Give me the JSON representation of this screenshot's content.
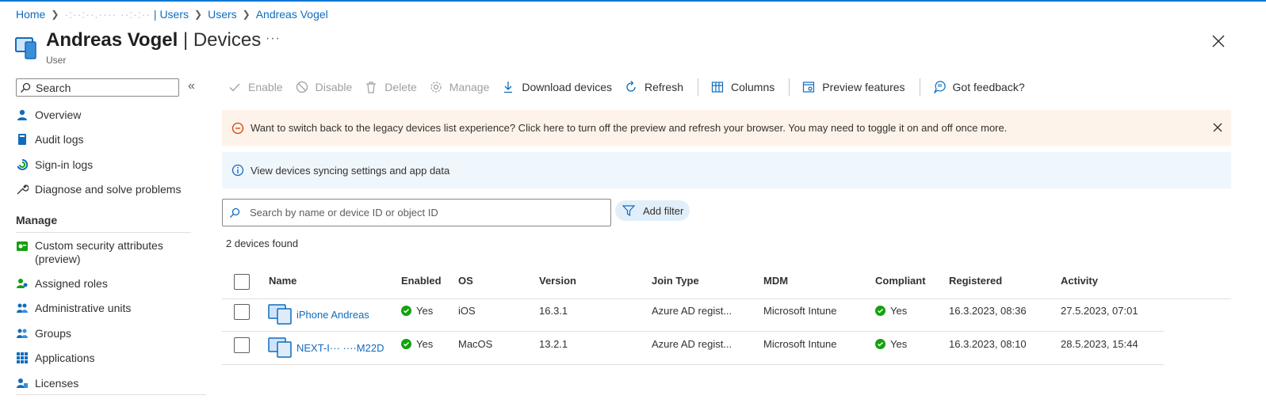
{
  "breadcrumb": {
    "home": "Home",
    "tenant": "·:··:··.···· ··:·:··",
    "tenant_suffix": "| Users",
    "users": "Users",
    "user": "Andreas Vogel"
  },
  "header": {
    "name": "Andreas Vogel",
    "section": "| Devices",
    "subtitle": "User",
    "more": "···"
  },
  "sidebar": {
    "search_placeholder": "Search",
    "collapse": "«",
    "items": [
      {
        "label": "Overview",
        "icon": "person-icon"
      },
      {
        "label": "Audit logs",
        "icon": "book-icon"
      },
      {
        "label": "Sign-in logs",
        "icon": "signin-icon"
      },
      {
        "label": "Diagnose and solve problems",
        "icon": "wrench-icon"
      }
    ],
    "manage_heading": "Manage",
    "manage_items": [
      {
        "label": "Custom security attributes",
        "label2": "(preview)",
        "icon": "attributes-icon"
      },
      {
        "label": "Assigned roles",
        "icon": "roles-icon"
      },
      {
        "label": "Administrative units",
        "icon": "units-icon"
      },
      {
        "label": "Groups",
        "icon": "groups-icon"
      },
      {
        "label": "Applications",
        "icon": "apps-icon"
      },
      {
        "label": "Licenses",
        "icon": "licenses-icon"
      }
    ]
  },
  "toolbar": {
    "enable": "Enable",
    "disable": "Disable",
    "delete": "Delete",
    "manage": "Manage",
    "download": "Download devices",
    "refresh": "Refresh",
    "columns": "Columns",
    "preview": "Preview features",
    "feedback": "Got feedback?"
  },
  "banners": {
    "warning": "Want to switch back to the legacy devices list experience? Click here to turn off the preview and refresh your browser. You may need to toggle it on and off once more.",
    "info": "View devices syncing settings and app data"
  },
  "search": {
    "placeholder": "Search by name or device ID or object ID",
    "add_filter": "Add filter"
  },
  "count_text": "2 devices found",
  "table": {
    "headers": [
      "Name",
      "Enabled",
      "OS",
      "Version",
      "Join Type",
      "MDM",
      "Compliant",
      "Registered",
      "Activity"
    ],
    "rows": [
      {
        "name": "iPhone Andreas",
        "enabled": "Yes",
        "os": "iOS",
        "version": "16.3.1",
        "join_type": "Azure AD regist...",
        "mdm": "Microsoft Intune",
        "compliant": "Yes",
        "registered": "16.3.2023, 08:36",
        "activity": "27.5.2023, 07:01"
      },
      {
        "name": "NEXT-I··· ····M22D",
        "enabled": "Yes",
        "os": "MacOS",
        "version": "13.2.1",
        "join_type": "Azure AD regist...",
        "mdm": "Microsoft Intune",
        "compliant": "Yes",
        "registered": "16.3.2023, 08:10",
        "activity": "28.5.2023, 15:44"
      }
    ]
  },
  "colors": {
    "link": "#0f6cbd",
    "success": "#13a10e",
    "warning_bg": "#fdf3ea",
    "info_bg": "#eff6fc",
    "warning_icon": "#d83b01"
  }
}
